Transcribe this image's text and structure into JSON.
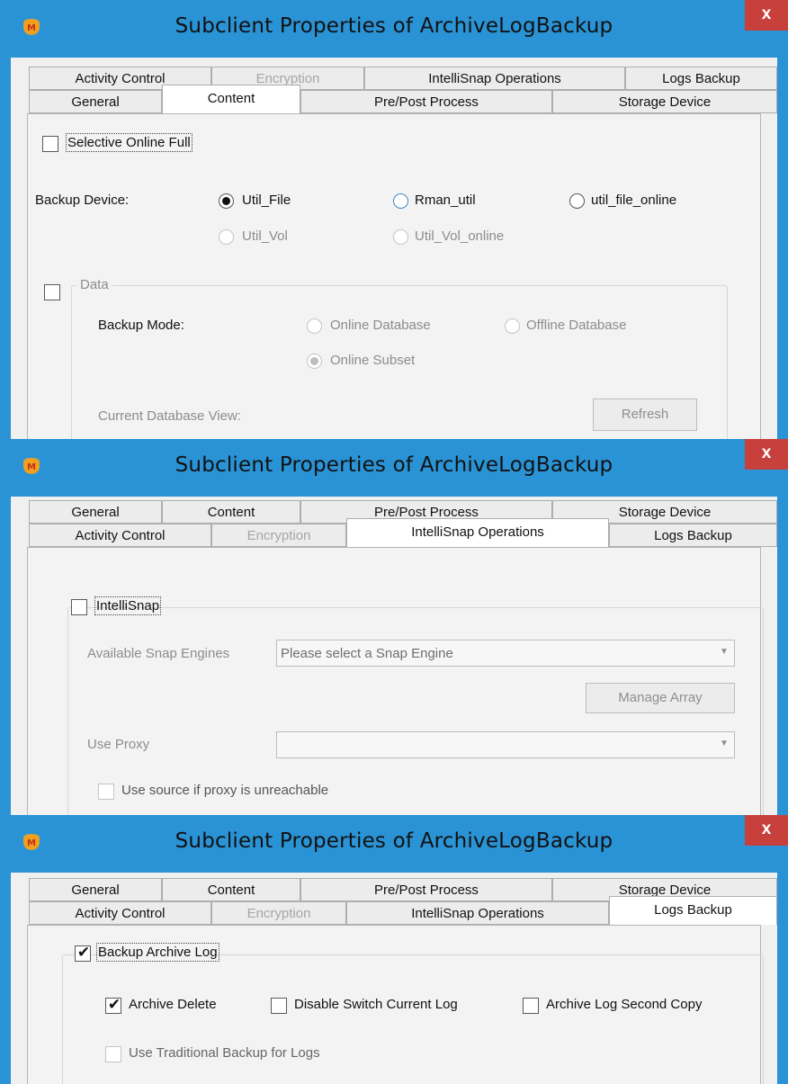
{
  "window_title": "Subclient Properties of ArchiveLogBackup",
  "close_label": "x",
  "tabs": {
    "general": "General",
    "content": "Content",
    "pre_post": "Pre/Post Process",
    "storage": "Storage Device",
    "activity": "Activity Control",
    "encryption": "Encryption",
    "intellisnap": "IntelliSnap Operations",
    "logs": "Logs Backup"
  },
  "panel1": {
    "selective_online_full": "Selective Online Full",
    "backup_device_label": "Backup Device:",
    "devices": {
      "util_file": "Util_File",
      "rman_util": "Rman_util",
      "util_file_online": "util_file_online",
      "util_vol": "Util_Vol",
      "util_vol_online": "Util_Vol_online"
    },
    "selected_device": "Util_File",
    "data_group": "Data",
    "backup_mode_label": "Backup Mode:",
    "modes": {
      "online_db": "Online Database",
      "offline_db": "Offline Database",
      "online_subset": "Online Subset"
    },
    "current_db_view": "Current Database View:",
    "refresh": "Refresh"
  },
  "panel2": {
    "intellisnap": "IntelliSnap",
    "available_engines": "Available Snap Engines",
    "engine_placeholder": "Please select a Snap Engine",
    "manage_array": "Manage Array",
    "use_proxy": "Use Proxy",
    "use_source": "Use source if proxy is unreachable"
  },
  "panel3": {
    "backup_archive_log": "Backup Archive Log",
    "archive_delete": "Archive Delete",
    "disable_switch": "Disable Switch Current Log",
    "second_copy": "Archive Log Second Copy",
    "traditional": "Use Traditional Backup for Logs",
    "checked": {
      "backup_archive_log": true,
      "archive_delete": true,
      "disable_switch": false,
      "second_copy": false,
      "traditional": false
    }
  },
  "colors": {
    "titlebar": "#2a93d5",
    "close": "#c8403b",
    "client": "#f0f0f0",
    "tab_active": "#ffffff"
  }
}
